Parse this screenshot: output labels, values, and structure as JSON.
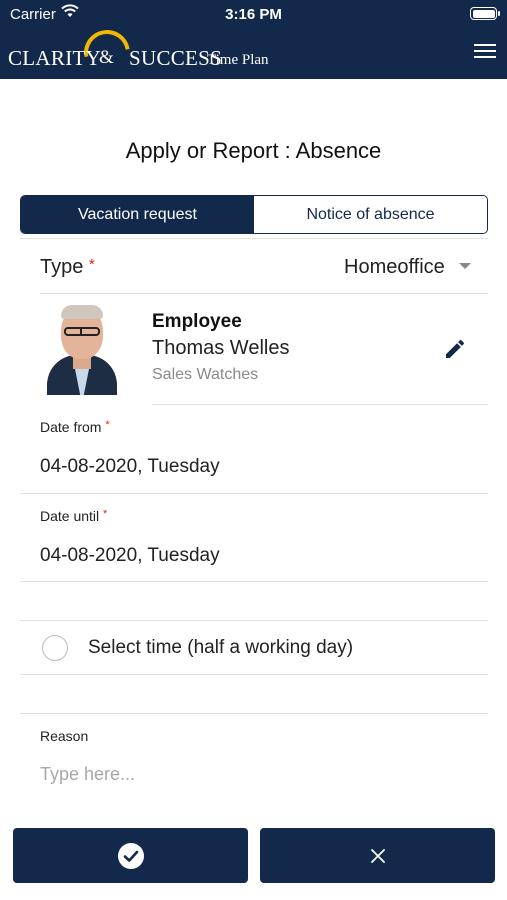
{
  "status_bar": {
    "carrier": "Carrier",
    "time": "3:16 PM"
  },
  "header": {
    "brand": {
      "word1": "CLARITY",
      "ampersand": "&",
      "word2": "SUCCESS",
      "word3": "Time Plan"
    },
    "menu_icon": "hamburger-menu-icon"
  },
  "page": {
    "title": "Apply or Report : Absence"
  },
  "tabs": [
    {
      "label": "Vacation request",
      "active": true
    },
    {
      "label": "Notice of absence",
      "active": false
    }
  ],
  "form": {
    "type": {
      "label": "Type",
      "required_mark": "*",
      "value": "Homeoffice"
    },
    "employee": {
      "heading": "Employee",
      "name": "Thomas Welles",
      "department": "Sales Watches"
    },
    "date_from": {
      "label": "Date from",
      "required_mark": "*",
      "value": "04-08-2020, Tuesday"
    },
    "date_until": {
      "label": "Date until",
      "required_mark": "*",
      "value": "04-08-2020, Tuesday"
    },
    "half_day": {
      "label": "Select time (half a working day)",
      "checked": false
    },
    "reason": {
      "label": "Reason",
      "placeholder": "Type here...",
      "value": ""
    }
  },
  "colors": {
    "primary": "#13294b",
    "accent": "#f2b705",
    "required": "#e0261b"
  }
}
